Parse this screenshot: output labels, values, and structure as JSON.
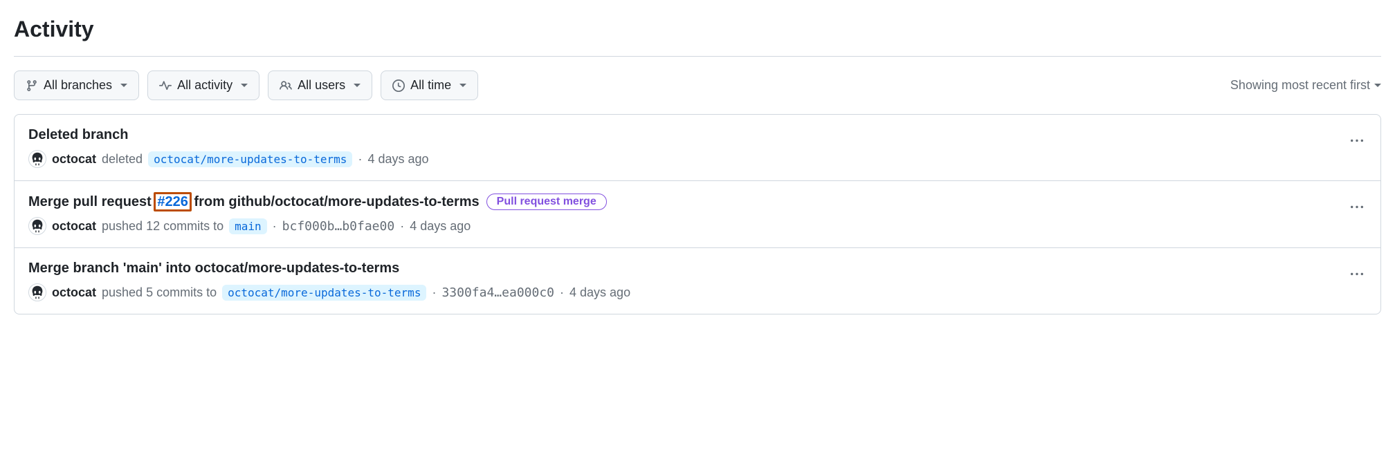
{
  "page": {
    "title": "Activity"
  },
  "filters": {
    "branches": "All branches",
    "activity": "All activity",
    "users": "All users",
    "time": "All time"
  },
  "sort": {
    "label": "Showing most recent first"
  },
  "items": [
    {
      "title_prefix": "Deleted branch",
      "title_pr": "",
      "title_suffix": "",
      "badge": "",
      "user": "octocat",
      "action": "deleted",
      "branch": "octocat/more-updates-to-terms",
      "commit_range": "",
      "time": "4 days ago",
      "pr_highlight": false
    },
    {
      "title_prefix": "Merge pull request ",
      "title_pr": "#226",
      "title_suffix": " from github/octocat/more-updates-to-terms",
      "badge": "Pull request merge",
      "user": "octocat",
      "action": "pushed 12 commits to",
      "branch": "main",
      "commit_range": "bcf000b…b0fae00",
      "time": "4 days ago",
      "pr_highlight": true
    },
    {
      "title_prefix": "Merge branch 'main' into octocat/more-updates-to-terms",
      "title_pr": "",
      "title_suffix": "",
      "badge": "",
      "user": "octocat",
      "action": "pushed 5 commits to",
      "branch": "octocat/more-updates-to-terms",
      "commit_range": "3300fa4…ea000c0",
      "time": "4 days ago",
      "pr_highlight": false
    }
  ]
}
